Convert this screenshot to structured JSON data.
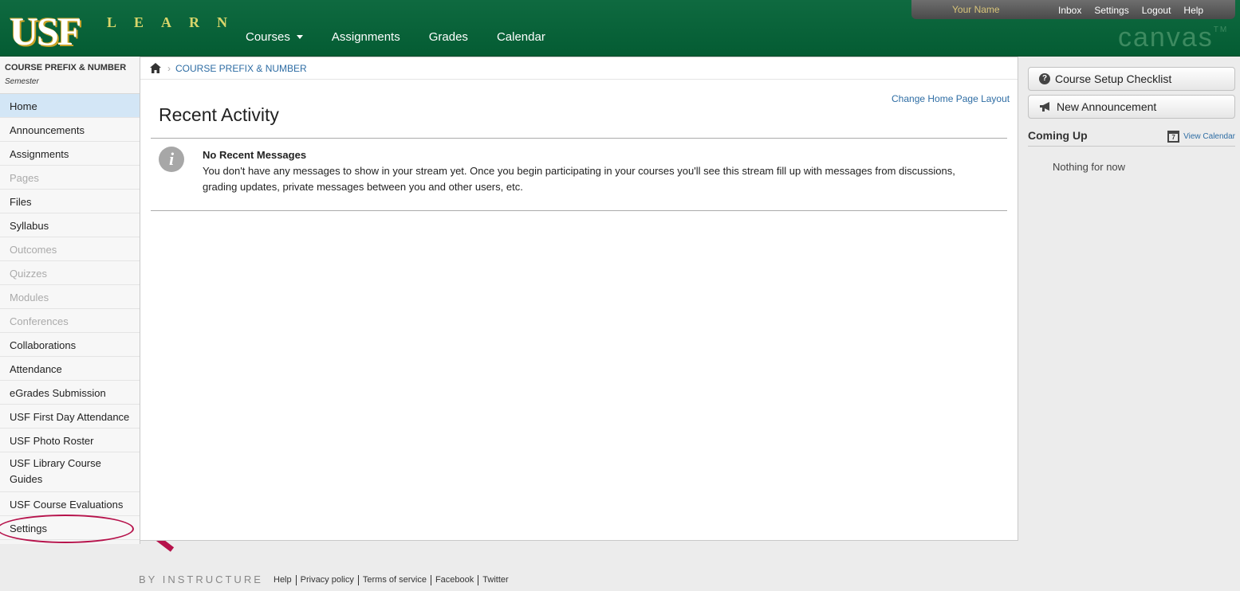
{
  "header": {
    "logo_text": "USF",
    "logo_sub": "LEARN",
    "brand": "canvas",
    "brand_tm": "TM",
    "nav": [
      "Courses",
      "Assignments",
      "Grades",
      "Calendar"
    ],
    "user_name": "Your Name",
    "user_links": [
      "Inbox",
      "Settings",
      "Logout",
      "Help"
    ]
  },
  "course": {
    "title": "COURSE PREFIX & NUMBER",
    "term": "Semester"
  },
  "sidebar": {
    "items": [
      {
        "label": "Home",
        "state": "active"
      },
      {
        "label": "Announcements",
        "state": "enabled"
      },
      {
        "label": "Assignments",
        "state": "enabled"
      },
      {
        "label": "Pages",
        "state": "disabled"
      },
      {
        "label": "Files",
        "state": "enabled"
      },
      {
        "label": "Syllabus",
        "state": "enabled"
      },
      {
        "label": "Outcomes",
        "state": "disabled"
      },
      {
        "label": "Quizzes",
        "state": "disabled"
      },
      {
        "label": "Modules",
        "state": "disabled"
      },
      {
        "label": "Conferences",
        "state": "disabled"
      },
      {
        "label": "Collaborations",
        "state": "enabled"
      },
      {
        "label": "Attendance",
        "state": "enabled"
      },
      {
        "label": "eGrades Submission",
        "state": "enabled"
      },
      {
        "label": "USF First Day Attendance",
        "state": "enabled"
      },
      {
        "label": "USF Photo Roster",
        "state": "enabled"
      },
      {
        "label": "USF Library Course Guides",
        "state": "enabled"
      },
      {
        "label": "USF Course Evaluations",
        "state": "enabled"
      },
      {
        "label": "Settings",
        "state": "enabled"
      }
    ]
  },
  "breadcrumb": {
    "current": "COURSE PREFIX & NUMBER"
  },
  "main": {
    "change_layout": "Change Home Page Layout",
    "title": "Recent Activity",
    "message_title": "No Recent Messages",
    "message_body": "You don't have any messages to show in your stream yet. Once you begin participating in your courses you'll see this stream fill up with messages from discussions, grading updates, private messages between you and other users, etc."
  },
  "right": {
    "setup_checklist": "Course Setup Checklist",
    "new_announcement": "New Announcement",
    "coming_up": "Coming Up",
    "view_calendar": "View Calendar",
    "calendar_day": "7",
    "nothing": "Nothing for now"
  },
  "footer": {
    "brand": "BY INSTRUCTURE",
    "links": [
      "Help",
      "Privacy policy",
      "Terms of service",
      "Facebook",
      "Twitter"
    ]
  },
  "colors": {
    "header_green": "#045c33",
    "link_blue": "#2e6da4",
    "annotation_red": "#b6124b",
    "active_item": "#d3e6f6"
  }
}
